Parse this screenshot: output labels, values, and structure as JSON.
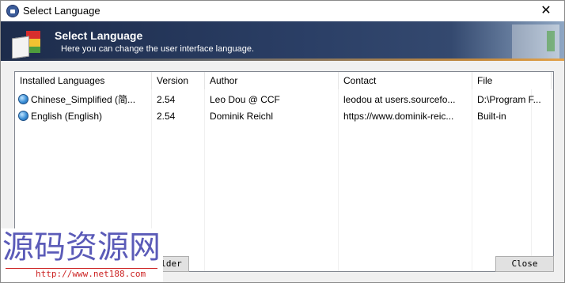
{
  "window": {
    "title": "Select Language",
    "close_glyph": "✕"
  },
  "banner": {
    "heading": "Select Language",
    "subheading": "Here you can change the user interface language."
  },
  "list": {
    "columns": [
      "Installed Languages",
      "Version",
      "Author",
      "Contact",
      "File"
    ],
    "rows": [
      {
        "language": "Chinese_Simplified (简...",
        "version": "2.54",
        "author": "Leo Dou @ CCF",
        "contact": "leodou at users.sourcefo...",
        "file": "D:\\Program F..."
      },
      {
        "language": "English (English)",
        "version": "2.54",
        "author": "Dominik Reichl",
        "contact": "https://www.dominik-reic...",
        "file": "Built-in"
      }
    ]
  },
  "buttons": {
    "folder_label": "lder",
    "close_label": "Close"
  },
  "watermark": {
    "main": "源码资源网",
    "sub": "http://www.net188.com"
  },
  "icons": {
    "app": "lock-icon",
    "language": "globe-icon",
    "banner": "language-book-flags-icon"
  },
  "colors": {
    "banner_dark": "#1d2c4b",
    "banner_accent": "#e2a24a",
    "watermark_text": "#5b5bb8",
    "watermark_url": "#cc2222"
  }
}
